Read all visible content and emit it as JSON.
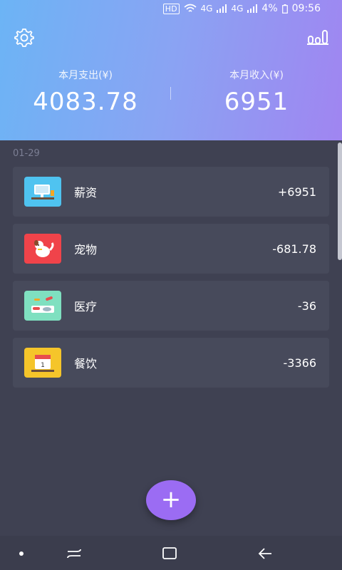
{
  "status": {
    "hd": "HD",
    "battery": "4%",
    "time": "09:56",
    "signal1": "4G",
    "signal2": "4G"
  },
  "summary": {
    "expense_label": "本月支出(¥)",
    "expense_value": "4083.78",
    "income_label": "本月收入(¥)",
    "income_value": "6951"
  },
  "date": "01-29",
  "items": [
    {
      "name": "薪资",
      "amount": "+6951",
      "icon": "salary-icon",
      "color": "#4fc3f0"
    },
    {
      "name": "宠物",
      "amount": "-681.78",
      "icon": "pet-icon",
      "color": "#f0434a"
    },
    {
      "name": "医疗",
      "amount": "-36",
      "icon": "medical-icon",
      "color": "#7fe0c0"
    },
    {
      "name": "餐饮",
      "amount": "-3366",
      "icon": "dining-icon",
      "color": "#f5c52a"
    }
  ],
  "fab": "+",
  "colors": {
    "accent": "#9b6cf3",
    "background": "#3f4152",
    "card": "#474a5b"
  }
}
